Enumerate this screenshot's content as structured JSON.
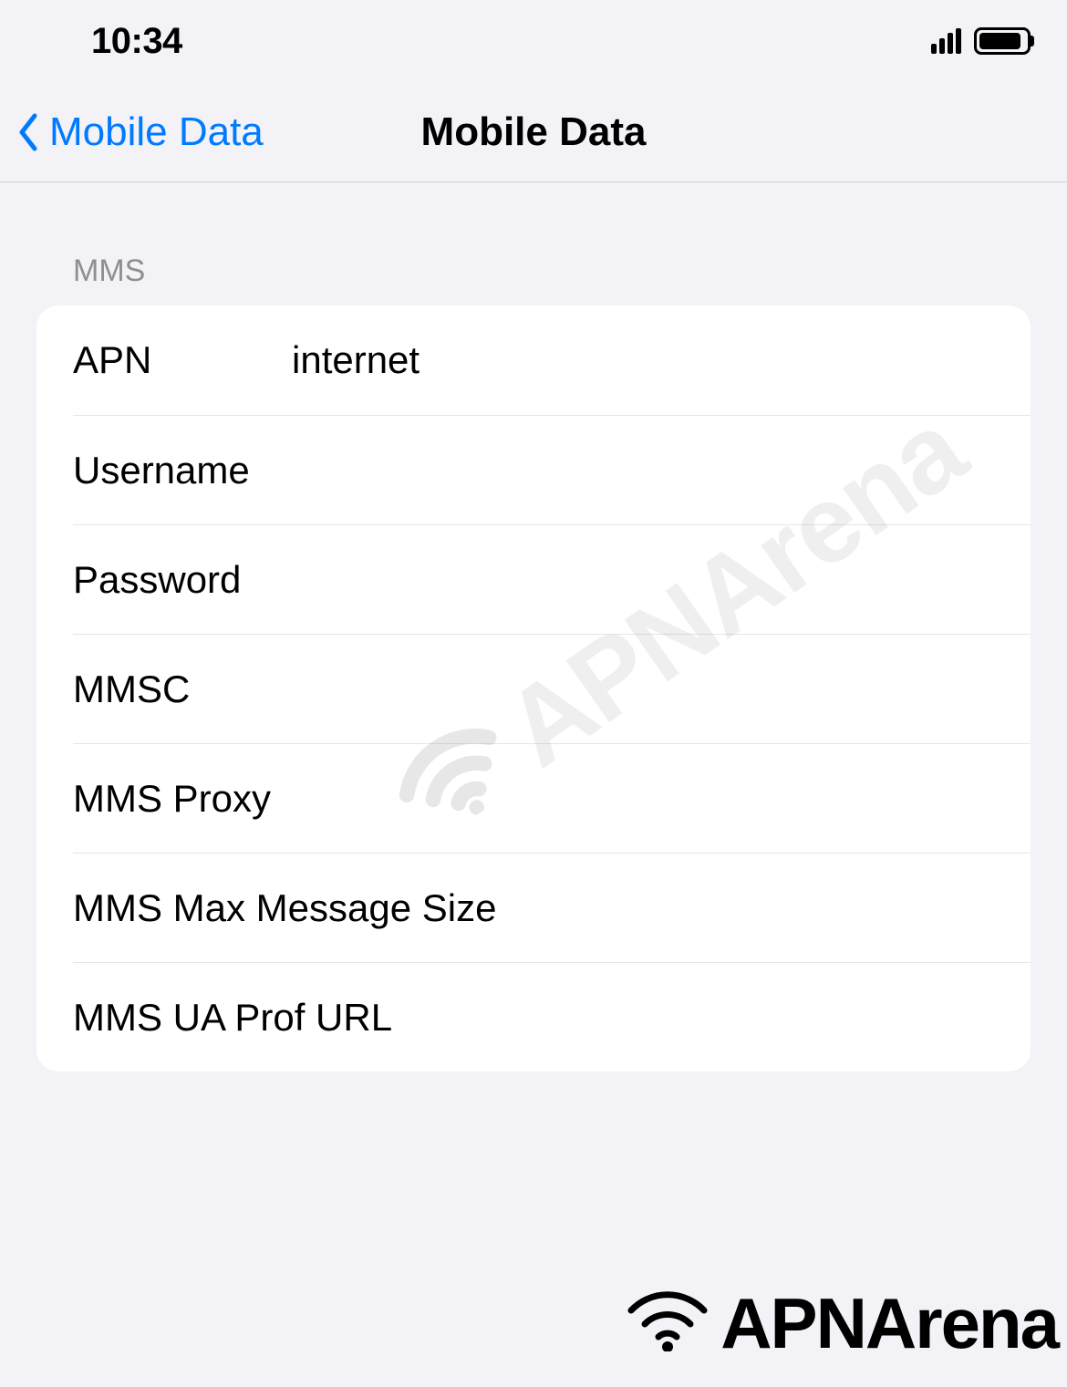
{
  "status_bar": {
    "time": "10:34"
  },
  "nav": {
    "back_label": "Mobile Data",
    "title": "Mobile Data"
  },
  "section": {
    "header": "MMS",
    "rows": [
      {
        "label": "APN",
        "value": "internet"
      },
      {
        "label": "Username",
        "value": ""
      },
      {
        "label": "Password",
        "value": ""
      },
      {
        "label": "MMSC",
        "value": ""
      },
      {
        "label": "MMS Proxy",
        "value": ""
      },
      {
        "label": "MMS Max Message Size",
        "value": ""
      },
      {
        "label": "MMS UA Prof URL",
        "value": ""
      }
    ]
  },
  "watermark": "APNArena",
  "brand": "APNArena"
}
